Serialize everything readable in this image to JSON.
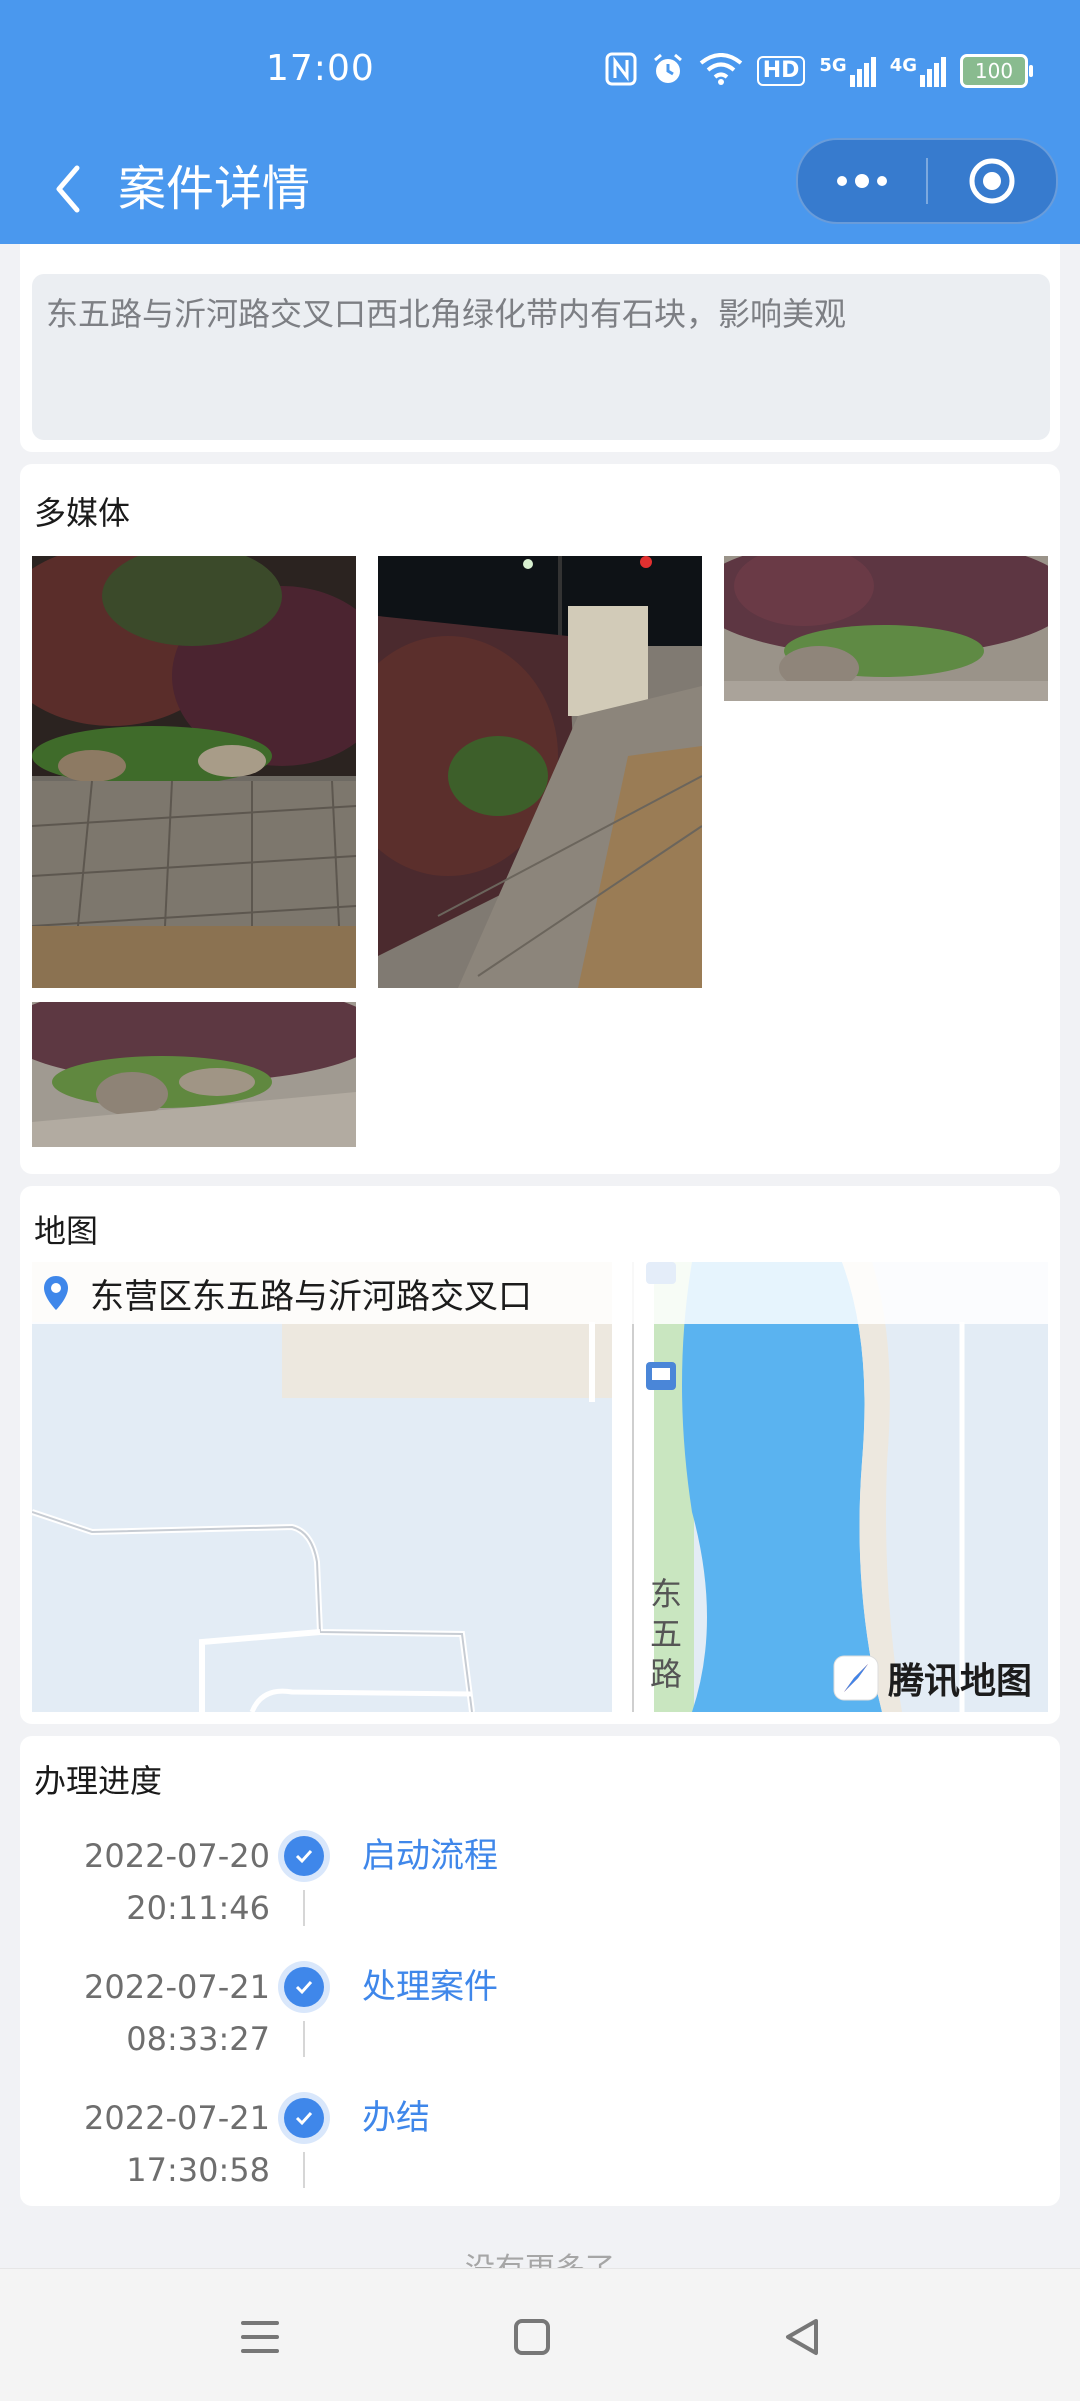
{
  "status_bar": {
    "time": "17:00",
    "icons": [
      "nfc-icon",
      "alarm-icon",
      "wifi-icon",
      "hd-icon",
      "signal-5g-icon",
      "signal-4g-icon"
    ],
    "hd_label": "HD",
    "net1_label": "5G",
    "net2_label": "4G",
    "battery_level": "100"
  },
  "nav": {
    "title": "案件详情",
    "back_icon": "chevron-left-icon",
    "more_icon": "more-dots-icon",
    "close_icon": "target-circle-icon"
  },
  "description": {
    "text": "东五路与沂河路交叉口西北角绿化带内有石块，影响美观"
  },
  "media": {
    "title": "多媒体",
    "photos": [
      {
        "name": "photo-1"
      },
      {
        "name": "photo-2"
      },
      {
        "name": "photo-3"
      },
      {
        "name": "photo-4"
      }
    ]
  },
  "map": {
    "title": "地图",
    "address": "东营区东五路与沂河路交叉口",
    "road_label": "东五路",
    "provider": "腾讯地图",
    "colors": {
      "water": "#5ab3f0",
      "land": "#e3ecf5",
      "green": "#c9e6c0"
    }
  },
  "progress": {
    "title": "办理进度",
    "steps": [
      {
        "date": "2022-07-20",
        "time": "20:11:46",
        "label": "启动流程"
      },
      {
        "date": "2022-07-21",
        "time": "08:33:27",
        "label": "处理案件"
      },
      {
        "date": "2022-07-21",
        "time": "17:30:58",
        "label": "办结"
      }
    ]
  },
  "footer": {
    "no_more": "没有更多了"
  },
  "colors": {
    "header": "#4a98ee",
    "accent": "#3f87ea"
  }
}
